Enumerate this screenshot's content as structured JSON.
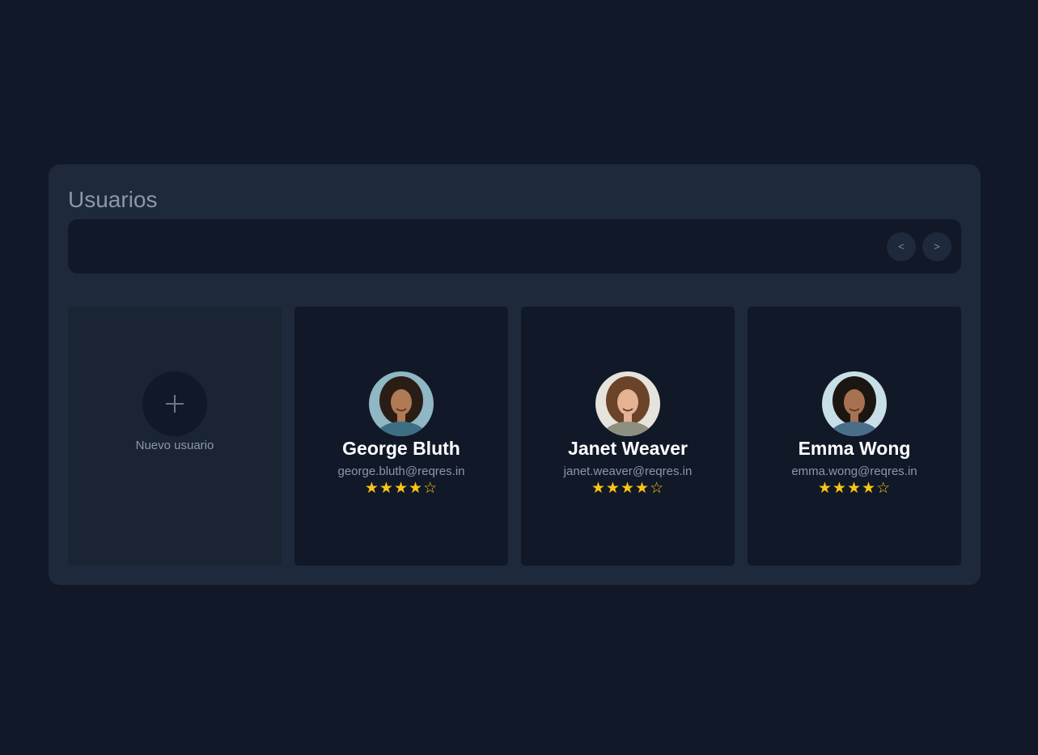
{
  "panel": {
    "title": "Usuarios"
  },
  "toolbar": {
    "prev_label": "<",
    "next_label": ">"
  },
  "new_user": {
    "label": "Nuevo usuario",
    "icon": "plus-icon"
  },
  "users": [
    {
      "name": "George Bluth",
      "email": "george.bluth@reqres.in",
      "rating": 4,
      "rating_max": 5,
      "avatar_bg": "#8fb7c4",
      "avatar_hair": "#2a1d16",
      "avatar_skin": "#b07a54",
      "avatar_shirt": "#3d6f84"
    },
    {
      "name": "Janet Weaver",
      "email": "janet.weaver@reqres.in",
      "rating": 4,
      "rating_max": 5,
      "avatar_bg": "#e6e2dc",
      "avatar_hair": "#6b4328",
      "avatar_skin": "#e3b394",
      "avatar_shirt": "#8d8f80"
    },
    {
      "name": "Emma Wong",
      "email": "emma.wong@reqres.in",
      "rating": 4,
      "rating_max": 5,
      "avatar_bg": "#c9dfe8",
      "avatar_hair": "#1c1612",
      "avatar_skin": "#a87250",
      "avatar_shirt": "#4a6d8a"
    }
  ],
  "colors": {
    "page_bg": "#111827",
    "panel_bg": "#1e293b",
    "star": "#fac415",
    "text_muted": "#8b97aa"
  }
}
